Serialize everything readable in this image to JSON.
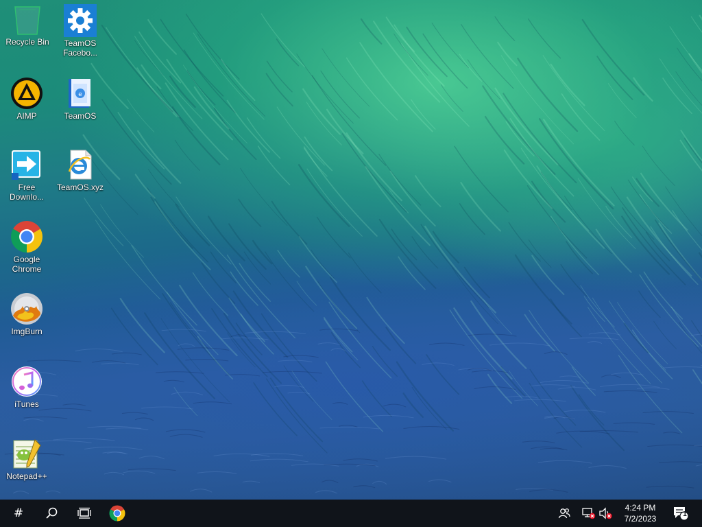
{
  "desktop": {
    "icons": [
      {
        "label": "Recycle Bin",
        "icon": "recycle-bin-icon"
      },
      {
        "label": "TeamOS\nFacebo...",
        "icon": "gear-icon"
      },
      {
        "label": "AIMP",
        "icon": "aimp-icon"
      },
      {
        "label": "TeamOS",
        "icon": "document-icon"
      },
      {
        "label": "Free\nDownlo...",
        "icon": "download-arrow-icon"
      },
      {
        "label": "TeamOS.xyz",
        "icon": "internet-explorer-icon"
      },
      {
        "label": "Google\nChrome",
        "icon": "chrome-icon"
      },
      {
        "label": "ImgBurn",
        "icon": "imgburn-disc-icon"
      },
      {
        "label": "iTunes",
        "icon": "itunes-icon"
      },
      {
        "label": "Notepad++",
        "icon": "notepad-plus-plus-icon"
      }
    ]
  },
  "taskbar": {
    "start_glyph": "#",
    "buttons": [
      {
        "icon": "start-icon"
      },
      {
        "icon": "search-icon"
      },
      {
        "icon": "task-view-icon"
      },
      {
        "icon": "chrome-icon"
      }
    ],
    "tray": {
      "icons": [
        "people-icon",
        "network-disconnected-icon",
        "volume-muted-icon"
      ],
      "time": "4:24 PM",
      "date": "7/2/2023",
      "notification_count": "1"
    }
  },
  "colors": {
    "taskbar_bg": "#10141a",
    "gear_tile_bg": "#1a7fd4",
    "error_badge": "#e81123"
  }
}
